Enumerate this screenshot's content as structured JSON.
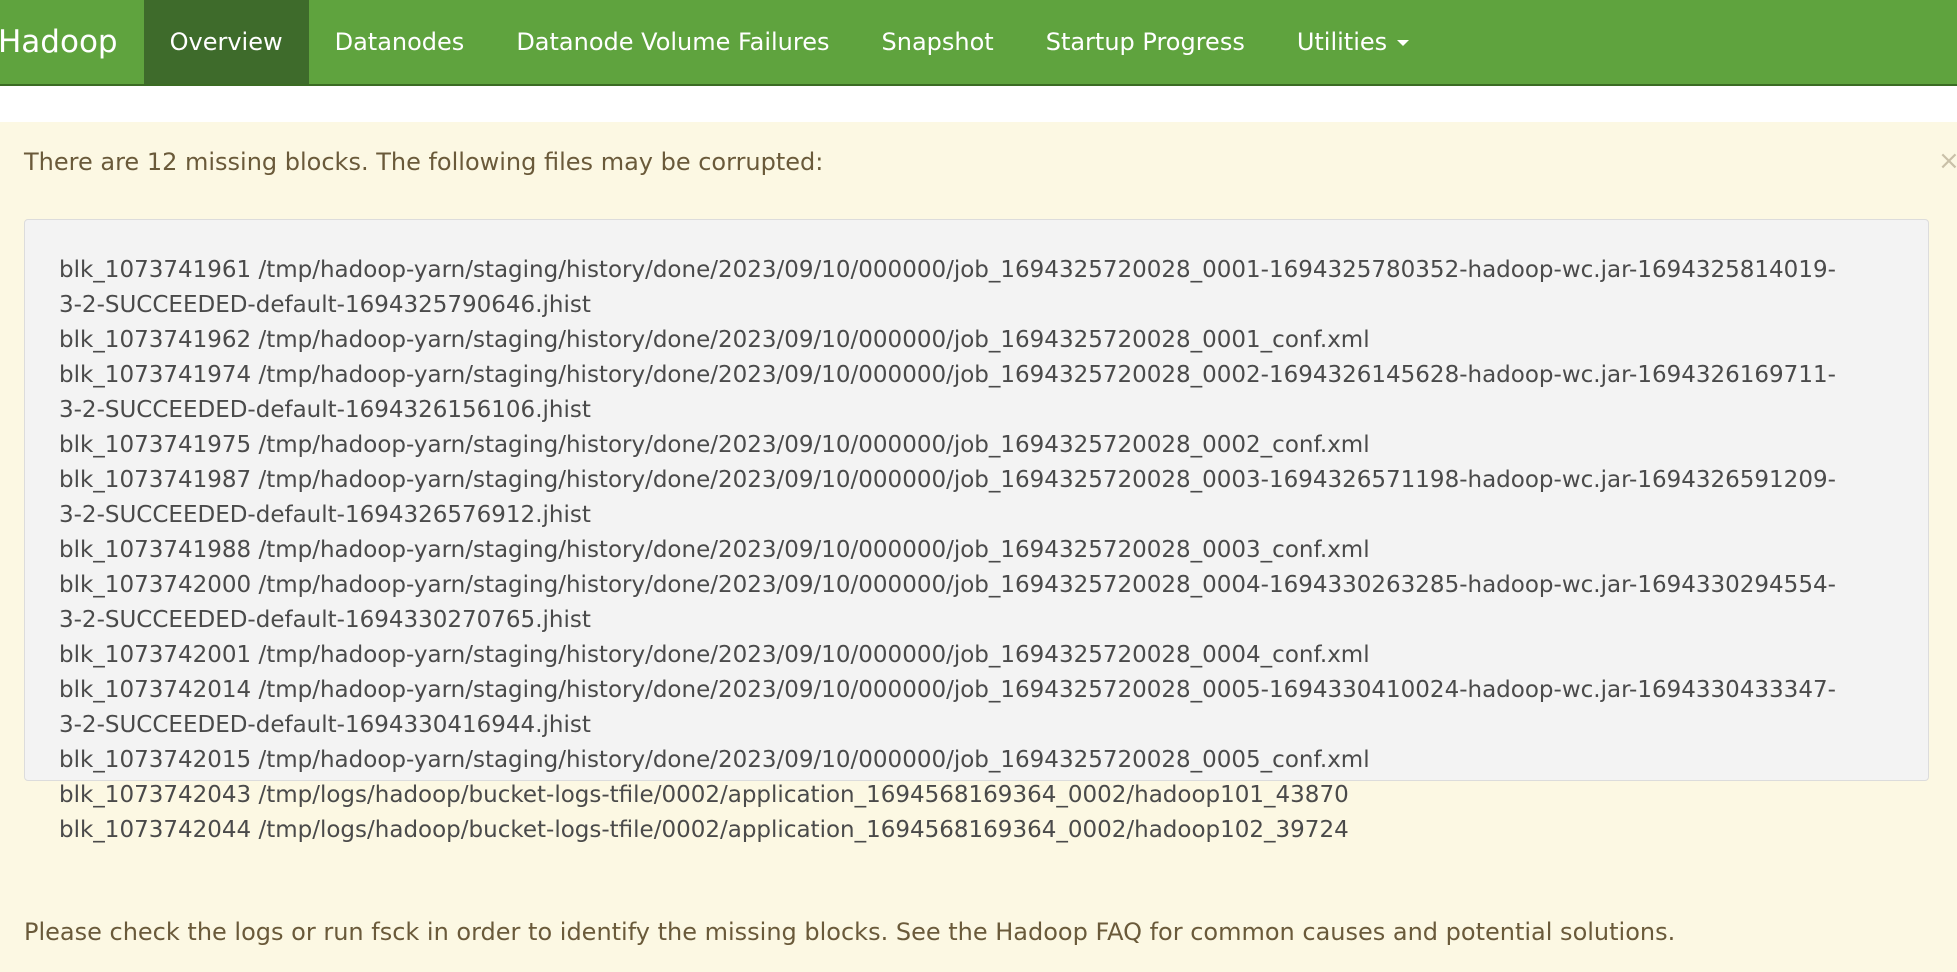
{
  "navbar": {
    "brand": "Hadoop",
    "items": [
      {
        "label": "Overview",
        "active": true
      },
      {
        "label": "Datanodes",
        "active": false
      },
      {
        "label": "Datanode Volume Failures",
        "active": false
      },
      {
        "label": "Snapshot",
        "active": false
      },
      {
        "label": "Startup Progress",
        "active": false
      },
      {
        "label": "Utilities",
        "active": false,
        "dropdown": true
      }
    ],
    "color": "#5fa33e",
    "active_color": "#3e6b2b"
  },
  "alert": {
    "message": "There are 12 missing blocks. The following files may be corrupted:",
    "close_icon": "×",
    "lines": [
      "blk_1073741961 /tmp/hadoop-yarn/staging/history/done/2023/09/10/000000/job_1694325720028_0001-1694325780352-hadoop-wc.jar-1694325814019-",
      "3-2-SUCCEEDED-default-1694325790646.jhist",
      "blk_1073741962 /tmp/hadoop-yarn/staging/history/done/2023/09/10/000000/job_1694325720028_0001_conf.xml",
      "blk_1073741974 /tmp/hadoop-yarn/staging/history/done/2023/09/10/000000/job_1694325720028_0002-1694326145628-hadoop-wc.jar-1694326169711-",
      "3-2-SUCCEEDED-default-1694326156106.jhist",
      "blk_1073741975 /tmp/hadoop-yarn/staging/history/done/2023/09/10/000000/job_1694325720028_0002_conf.xml",
      "blk_1073741987 /tmp/hadoop-yarn/staging/history/done/2023/09/10/000000/job_1694325720028_0003-1694326571198-hadoop-wc.jar-1694326591209-",
      "3-2-SUCCEEDED-default-1694326576912.jhist",
      "blk_1073741988 /tmp/hadoop-yarn/staging/history/done/2023/09/10/000000/job_1694325720028_0003_conf.xml",
      "blk_1073742000 /tmp/hadoop-yarn/staging/history/done/2023/09/10/000000/job_1694325720028_0004-1694330263285-hadoop-wc.jar-1694330294554-",
      "3-2-SUCCEEDED-default-1694330270765.jhist",
      "blk_1073742001 /tmp/hadoop-yarn/staging/history/done/2023/09/10/000000/job_1694325720028_0004_conf.xml",
      "blk_1073742014 /tmp/hadoop-yarn/staging/history/done/2023/09/10/000000/job_1694325720028_0005-1694330410024-hadoop-wc.jar-1694330433347-",
      "3-2-SUCCEEDED-default-1694330416944.jhist",
      "blk_1073742015 /tmp/hadoop-yarn/staging/history/done/2023/09/10/000000/job_1694325720028_0005_conf.xml",
      "blk_1073742043 /tmp/logs/hadoop/bucket-logs-tfile/0002/application_1694568169364_0002/hadoop101_43870",
      "blk_1073742044 /tmp/logs/hadoop/bucket-logs-tfile/0002/application_1694568169364_0002/hadoop102_39724"
    ],
    "footer": "Please check the logs or run fsck in order to identify the missing blocks. See the Hadoop FAQ for common causes and potential solutions.",
    "background": "#fcf8e3"
  }
}
